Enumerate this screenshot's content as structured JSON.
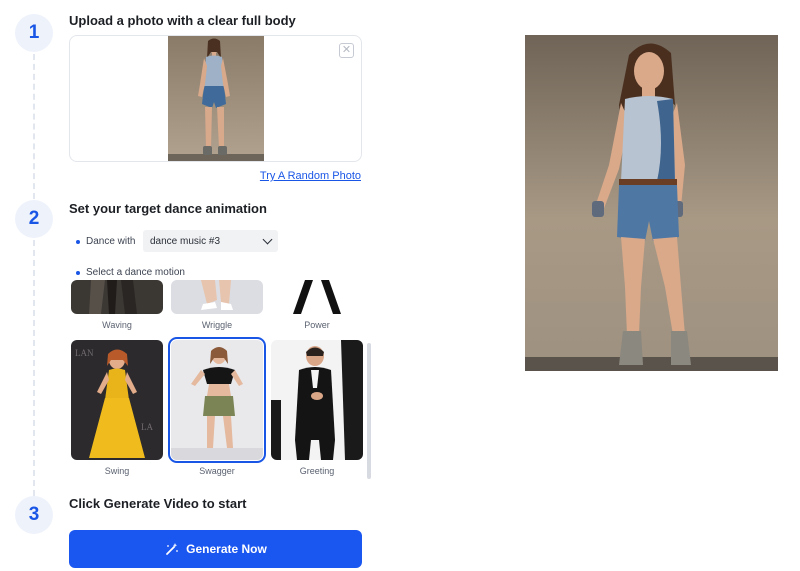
{
  "steps": [
    {
      "number": "1",
      "title": "Upload a photo with a clear full body"
    },
    {
      "number": "2",
      "title": "Set your target dance animation"
    },
    {
      "number": "3",
      "title": "Click Generate Video to start"
    }
  ],
  "upload": {
    "remove_icon": "close-icon",
    "random_link": "Try A Random Photo"
  },
  "dance": {
    "dance_with_label": "Dance with",
    "selected_music": "dance music #3",
    "select_motion_label": "Select a dance motion",
    "motions": [
      {
        "label": "Waving"
      },
      {
        "label": "Wriggle"
      },
      {
        "label": "Power"
      },
      {
        "label": "Swing"
      },
      {
        "label": "Swagger"
      },
      {
        "label": "Greeting"
      }
    ],
    "selected_motion": "Swagger"
  },
  "generate": {
    "label": "Generate Now",
    "icon": "magic-wand-icon"
  },
  "colors": {
    "accent": "#1a56f0",
    "step_badge_bg": "#eef2fb"
  }
}
